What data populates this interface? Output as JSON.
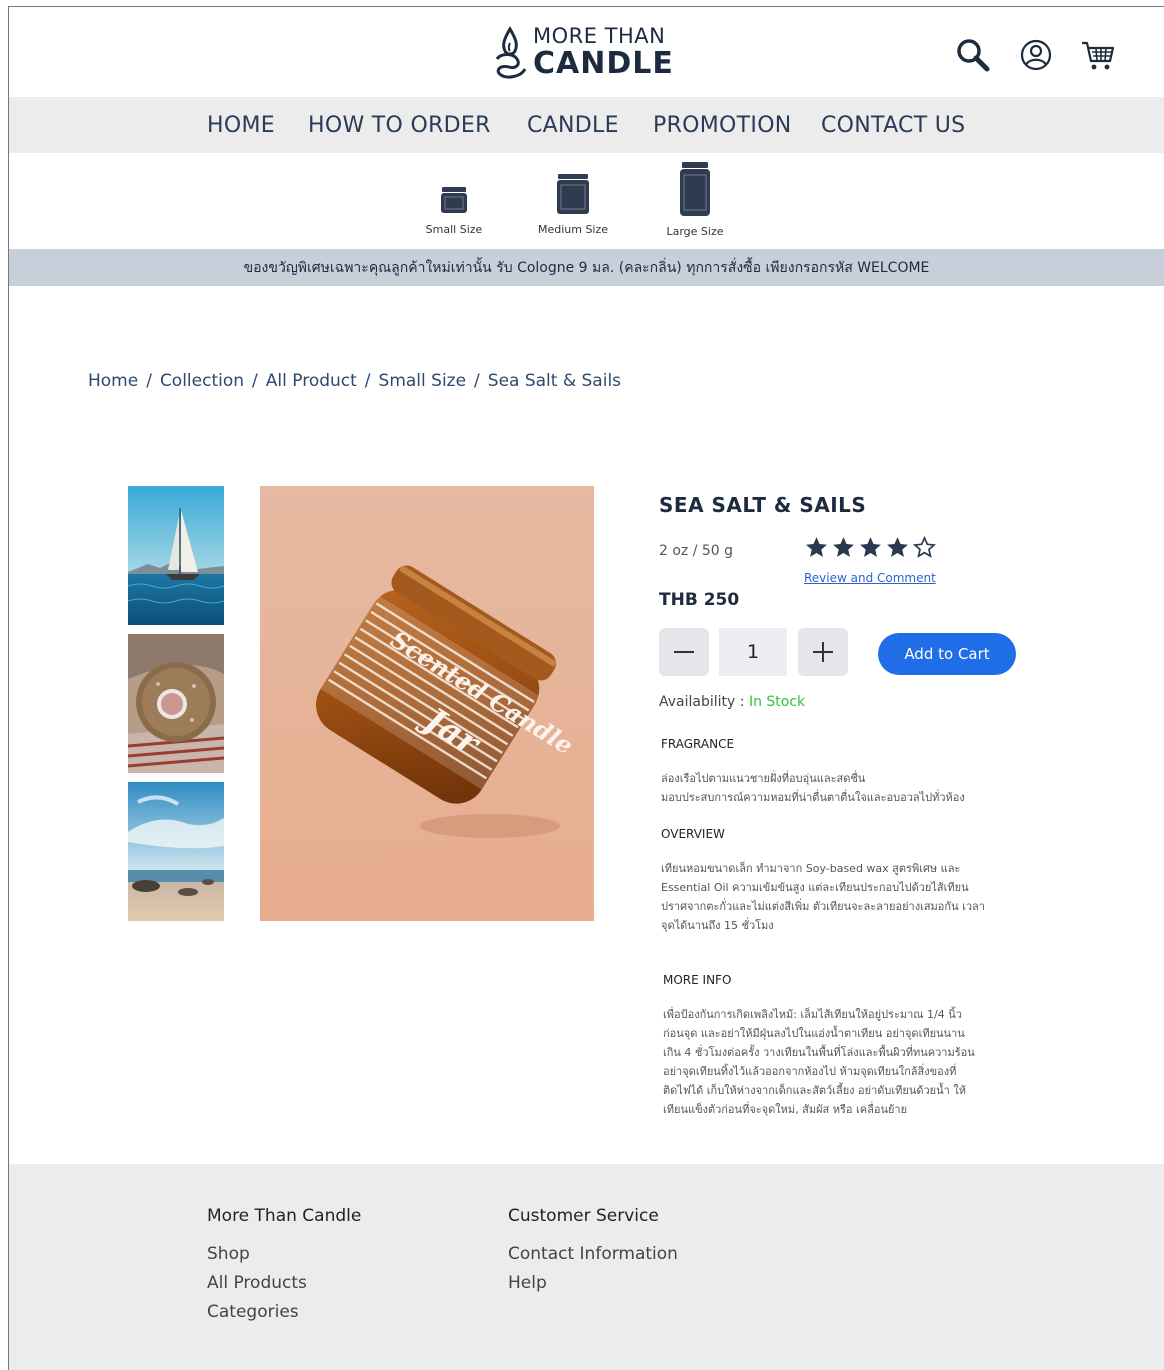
{
  "brand": {
    "line1": "MORE THAN",
    "line2": "CANDLE"
  },
  "header_icons": [
    "search-icon",
    "account-icon",
    "cart-icon"
  ],
  "nav": [
    {
      "label": "HOME"
    },
    {
      "label": "HOW TO ORDER"
    },
    {
      "label": "CANDLE"
    },
    {
      "label": "PROMOTION"
    },
    {
      "label": "CONTACT US"
    }
  ],
  "sizes": [
    {
      "label": "Small Size"
    },
    {
      "label": "Medium Size"
    },
    {
      "label": "Large Size"
    }
  ],
  "promo_text": "ของขวัญพิเศษเฉพาะคุณลูกค้าใหม่เท่านั้น รับ Cologne 9 มล. (คละกลิ่น) ทุกการสั่งซื้อ เพียงกรอกรหัส WELCOME",
  "breadcrumb": [
    "Home",
    "Collection",
    "All Product",
    "Small Size",
    "Sea Salt & Sails"
  ],
  "breadcrumb_sep": "/",
  "product": {
    "title": "SEA SALT & SAILS",
    "weight": "2 oz / 50 g",
    "rating": 4,
    "rating_max": 5,
    "review_link": "Review and Comment",
    "price": "THB 250",
    "quantity": "1",
    "add_to_cart": "Add to Cart",
    "availability_label": "Availability :",
    "availability_value": "In Stock",
    "jar_label_1": "Scented Candle",
    "jar_label_2": "Jar"
  },
  "sections": {
    "fragrance": {
      "heading": "FRAGRANCE",
      "lines": [
        "ล่องเรือไปตามแนวชายฝั่งที่อบอุ่นและสดชื่น",
        "มอบประสบการณ์ความหอมที่น่าตื่นตาตื่นใจและอบอวลไปทั่วห้อง"
      ]
    },
    "overview": {
      "heading": "OVERVIEW",
      "lines": [
        "เทียนหอมขนาดเล็ก ทำมาจาก Soy-based wax สูตรพิเศษ และ",
        "Essential Oil ความเข้มข้นสูง แต่ละเทียนประกอบไปด้วยไส้เทียน",
        "ปราศจากตะกั่วและไม่แต่งสีเพิ่ม ตัวเทียนจะละลายอย่างเสมอกัน เวลา",
        "จุดได้นานถึง 15 ชั่วโมง"
      ]
    },
    "more_info": {
      "heading": "MORE INFO",
      "lines": [
        "เพื่อป้องกันการเกิดเพลิงไหม้: เล็มไส้เทียนให้อยู่ประมาณ 1/4 นิ้ว",
        "ก่อนจุด และอย่าให้มีฝุ่นลงไปในแอ่งน้ำตาเทียน อย่าจุดเทียนนาน",
        "เกิน 4 ชั่วโมงต่อครั้ง วางเทียนในพื้นที่โล่งและพื้นผิวที่ทนความร้อน",
        "อย่าจุดเทียนทิ้งไว้แล้วออกจากห้องไป ห้ามจุดเทียนใกล้สิ่งของที่",
        "ติดไฟได้ เก็บให้ห่างจากเด็กและสัตว์เลี้ยง อย่าดับเทียนด้วยน้ำ ให้",
        "เทียนแข็งตัวก่อนที่จะจุดใหม่, สัมผัส หรือ เคลื่อนย้าย"
      ]
    }
  },
  "footer": {
    "col1": {
      "heading": "More Than Candle",
      "links": [
        "Shop",
        "All Products",
        "Categories"
      ]
    },
    "col2": {
      "heading": "Customer Service",
      "links": [
        "Contact Information",
        "Help"
      ]
    }
  },
  "colors": {
    "navy": "#1d2b3f",
    "accent_blue": "#1f6ee8",
    "stock_green": "#36c23a",
    "promo_bg": "#c7d0da",
    "nav_bg": "#ececed"
  }
}
